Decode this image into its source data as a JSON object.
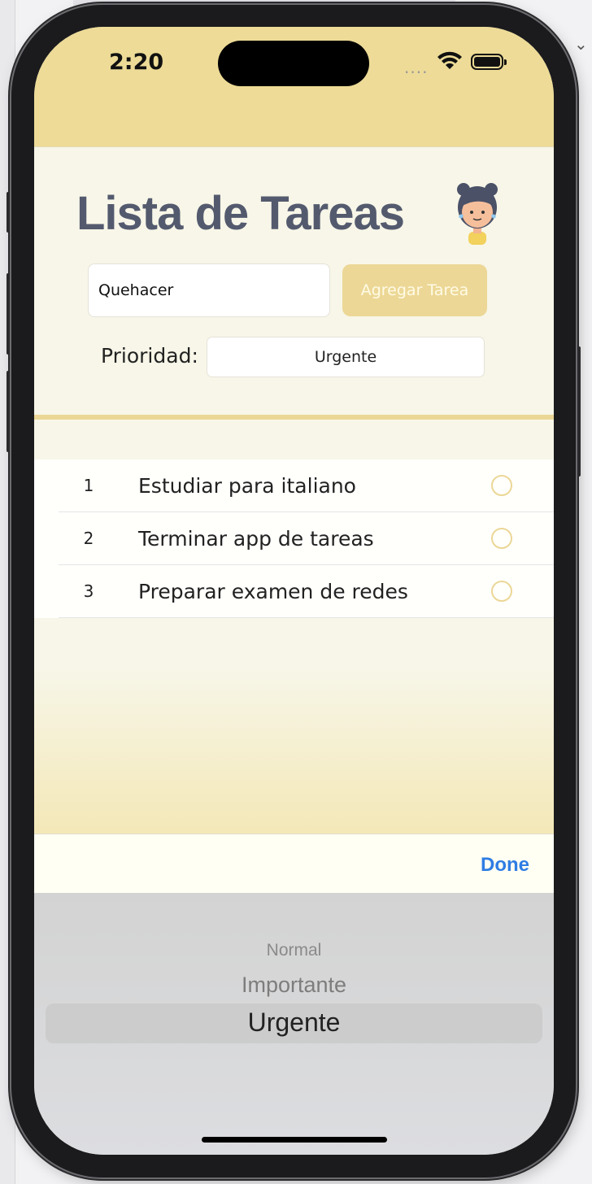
{
  "status_bar": {
    "time": "2:20",
    "signal": "....",
    "icons": [
      "wifi-icon",
      "battery-icon"
    ]
  },
  "header": {
    "title": "Lista de Tareas",
    "avatar_icon": "girl-avatar-icon"
  },
  "form": {
    "task_input_value": "Quehacer",
    "add_button_label": "Agregar Tarea",
    "priority_label": "Prioridad:",
    "priority_value": "Urgente"
  },
  "tasks": [
    {
      "num": "1",
      "text": "Estudiar para italiano"
    },
    {
      "num": "2",
      "text": "Terminar app de tareas"
    },
    {
      "num": "3",
      "text": "Preparar examen de redes"
    }
  ],
  "picker": {
    "done_label": "Done",
    "options": [
      "Normal",
      "Importante",
      "Urgente"
    ],
    "selected": "Urgente"
  },
  "colors": {
    "accent": "#ECD796",
    "header_bg": "#EDDB97",
    "title": "#545A6E",
    "done": "#2F7DE4",
    "background": "#F7F6E8"
  }
}
